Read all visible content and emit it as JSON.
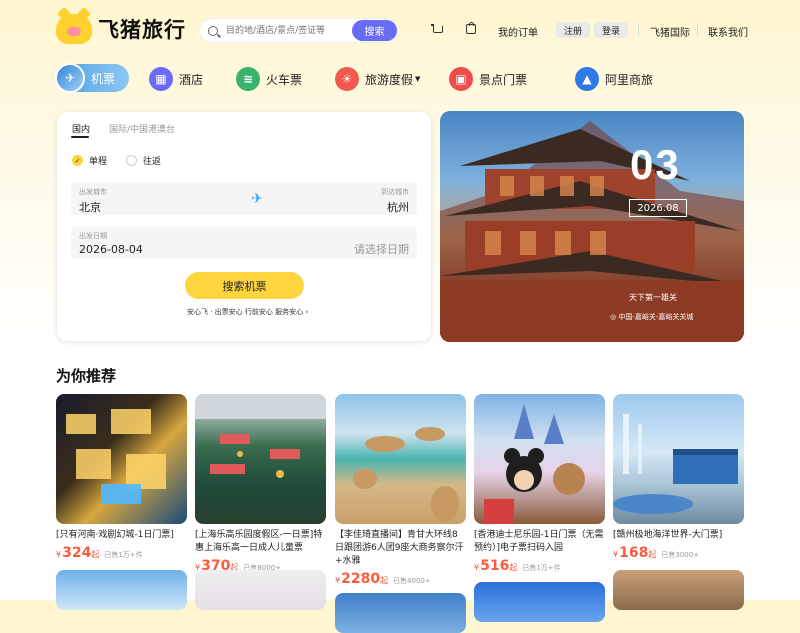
{
  "header": {
    "logo_text": "飞猪旅行",
    "search_placeholder": "目的地/酒店/景点/签证等",
    "search_button": "搜索",
    "links": {
      "orders": "我的订单",
      "register": "注册",
      "login": "登录",
      "international": "飞猪国际",
      "contact": "联系我们"
    }
  },
  "nav": [
    {
      "label": "机票",
      "icon": "plane-icon",
      "color": "#3d9be0"
    },
    {
      "label": "酒店",
      "icon": "hotel-icon",
      "color": "#6a6cf6"
    },
    {
      "label": "火车票",
      "icon": "train-icon",
      "color": "#3ab26b"
    },
    {
      "label": "旅游度假",
      "icon": "vacation-icon",
      "color": "#f05a4a"
    },
    {
      "label": "景点门票",
      "icon": "ticket-icon",
      "color": "#f04c4c"
    },
    {
      "label": "阿里商旅",
      "icon": "business-travel-icon",
      "color": "#2f78e8"
    }
  ],
  "booking": {
    "tab_domestic": "国内",
    "tab_international": "国际/中国港澳台",
    "trip_oneway": "单程",
    "trip_round": "往返",
    "from_label": "出发城市",
    "from_value": "北京",
    "to_label": "到达城市",
    "to_value": "杭州",
    "date_label": "出发日期",
    "date_value": "2026-08-04",
    "return_placeholder": "请选择日期",
    "search_button": "搜索机票",
    "assurance": "安心飞 · 出票安心 行前安心 服务安心 ›"
  },
  "banner": {
    "day": "03",
    "date": "2026.08",
    "caption": "天下第一雄关",
    "location": "中国-嘉峪关-嘉峪关关城"
  },
  "recommend": {
    "title": "为你推荐",
    "items": [
      {
        "title": "[只有河南·戏剧幻城-1日门票]",
        "price": "324",
        "sold": "已售1万+件"
      },
      {
        "title": "[上海乐高乐园度假区-一日票]特惠上海乐高一日成人儿童票",
        "price": "370",
        "sold": "已售8000+"
      },
      {
        "title": "【李佳琦直播间】青甘大环线8日跟团游6人团9座大商务察尔汗+水雅",
        "price": "2280",
        "sold": "已售4000+"
      },
      {
        "title": "[香港迪士尼乐园-1日门票（无需预约）]电子票扫码入园",
        "price": "516",
        "sold": "已售1万+件"
      },
      {
        "title": "[赣州极地海洋世界-大门票]",
        "price": "168",
        "sold": "已售3000+"
      }
    ],
    "yen": "¥",
    "qi": "起"
  }
}
